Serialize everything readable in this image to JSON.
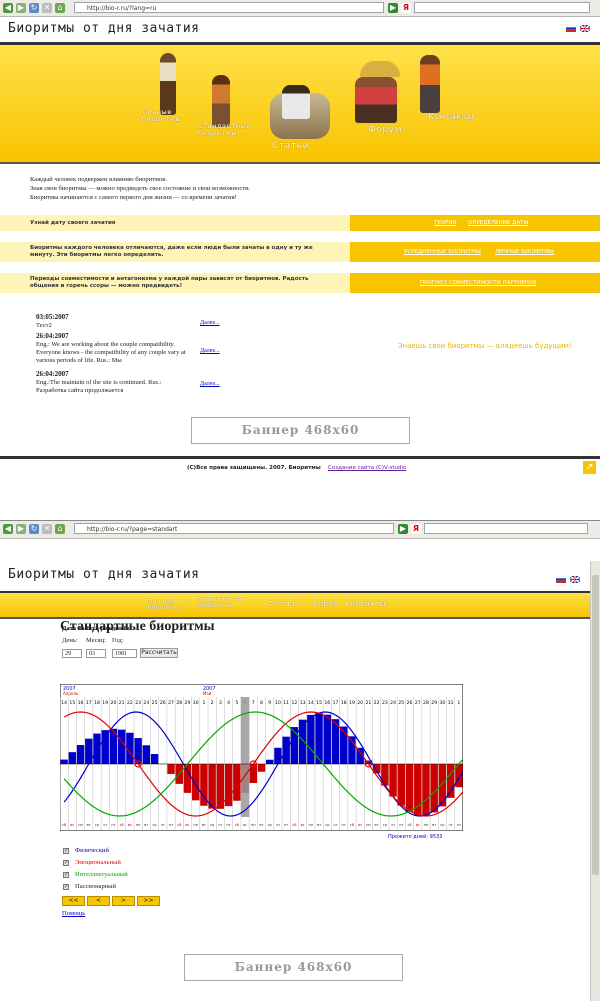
{
  "window1": {
    "url": "http://bio-r.ru/?lang=ru",
    "search_letter": "Я",
    "site_title": "Биоритмы от дня зачатия",
    "nav": {
      "item1": "Личные биоритмы",
      "item2": "Стандартные биоритмы",
      "item3": "Статьи",
      "item4": "Форум",
      "item5": "Контакты"
    },
    "intro": [
      "Каждый человек подвержен влиянию биоритмов.",
      "Зная свои биоритмы — можно предвидеть свое состояние и свои возможности.",
      "Биоритмы начинаются с самого первого дня жизни — со времени зачатия!"
    ],
    "strip1": {
      "text": "Узнай дату своего зачатия",
      "link1": "ТЕОРИЯ",
      "link2": "ОПРЕДЕЛЕНИЕ ДАТЫ"
    },
    "strip2": {
      "text": "Биоритмы каждого человека отличаются, даже если люди были зачаты в одну и ту же минуту. Эти биоритмы легко определить.",
      "link1": "УСРЕДНЕННЫЕ БИОРИТМЫ",
      "link2": "ЛИЧНЫЕ БИОРИТМЫ"
    },
    "strip3": {
      "text": "Периоды совместимости и антагонизма у каждой пары зависят от биоритмов. Радость общения и горечь ссоры — можно предвидеть!",
      "link1": "ПРОГНОЗ СОВМЕСТИМОСТИ ПАРТНЕРОВ"
    },
    "news": [
      {
        "date": "03:05:2007",
        "text": "Тест2",
        "more": "Далее..."
      },
      {
        "date": "26:04:2007",
        "text": "Eng.: We are working about the couple compatibility. Everyone knows - the compatibility of any couple vary at various periods of life. Rus.: Мы",
        "more": "Далее..."
      },
      {
        "date": "26:04:2007",
        "text": "Eng.:The maintain of the site is continued. Rus.: Разработка сайта продолжается",
        "more": "Далее..."
      }
    ],
    "slogan": "Знаешь свои биоритмы — владеешь будущим!",
    "banner": "Баннер 468x60",
    "footer": "(С)Все права защищены. 2007. Биоритмы",
    "footer_link": "Создание сайта (С)V-studio"
  },
  "window2": {
    "url": "http://bio-r.ru/?page=standart",
    "search_letter": "Я",
    "site_title": "Биоритмы от дня зачатия",
    "nav": {
      "item1": "Личные биоритмы",
      "item2": "Стандартные биоритмы",
      "item3": "Статьи",
      "item4": "Форум",
      "item5": "Контакты"
    },
    "heading": "Стандартные биоритмы",
    "form": {
      "label": "Дата вашего рождения:",
      "day_label": "День:",
      "month_label": "Месяц:",
      "year_label": "Год:",
      "day": "29",
      "month": "03",
      "year": "1981",
      "submit": "Рассчитать"
    },
    "days_lived": "Прожито дней: 9533",
    "legend": {
      "physical": "Физический",
      "emotional": "Эмоциональный",
      "intellectual": "Интеллектуальный",
      "passive": "Пассионарный"
    },
    "buttons": {
      "prev2": "<<",
      "prev": "<",
      "next": ">",
      "next2": ">>"
    },
    "help": "Помощь",
    "banner": "Баннер 468x60"
  },
  "chart_data": {
    "type": "line",
    "year_labels": [
      {
        "label": "2007",
        "month": "Апрель"
      },
      {
        "label": "2007",
        "month": "Май"
      }
    ],
    "days": [
      "14",
      "15",
      "16",
      "17",
      "18",
      "19",
      "20",
      "21",
      "22",
      "23",
      "24",
      "25",
      "26",
      "27",
      "28",
      "29",
      "30",
      "1",
      "2",
      "3",
      "4",
      "5",
      "6",
      "7",
      "8",
      "9",
      "10",
      "11",
      "12",
      "13",
      "14",
      "15",
      "16",
      "17",
      "18",
      "19",
      "20",
      "21",
      "22",
      "23",
      "24",
      "25",
      "26",
      "27",
      "28",
      "29",
      "30",
      "31",
      "1"
    ],
    "weekdays": [
      "сб",
      "вс",
      "пн",
      "вт",
      "ср",
      "чт",
      "пт",
      "сб",
      "вс",
      "пн",
      "вт",
      "ср",
      "чт",
      "пт",
      "сб",
      "вс",
      "пн",
      "вт",
      "ср",
      "чт",
      "пт",
      "сб",
      "вс",
      "пн",
      "вт",
      "ср",
      "чт",
      "пт",
      "сб",
      "вс",
      "пн",
      "вт",
      "ср",
      "чт",
      "пт",
      "сб",
      "вс",
      "пн",
      "вт",
      "ср",
      "чт",
      "пт",
      "сб",
      "вс",
      "пн",
      "вт",
      "ср",
      "чт",
      "пт"
    ],
    "today_index": 22,
    "ylim": [
      -1,
      1
    ],
    "series": [
      {
        "key": "physical",
        "color": "#0000cc",
        "period": 23
      },
      {
        "key": "emotional",
        "color": "#e00000",
        "period": 28
      },
      {
        "key": "intellectual",
        "color": "#00aa00",
        "period": 33
      }
    ]
  },
  "colors": {
    "accent": "#f8c400",
    "physical": "#0000cc",
    "emotional": "#e00000",
    "intellectual": "#00aa00"
  }
}
